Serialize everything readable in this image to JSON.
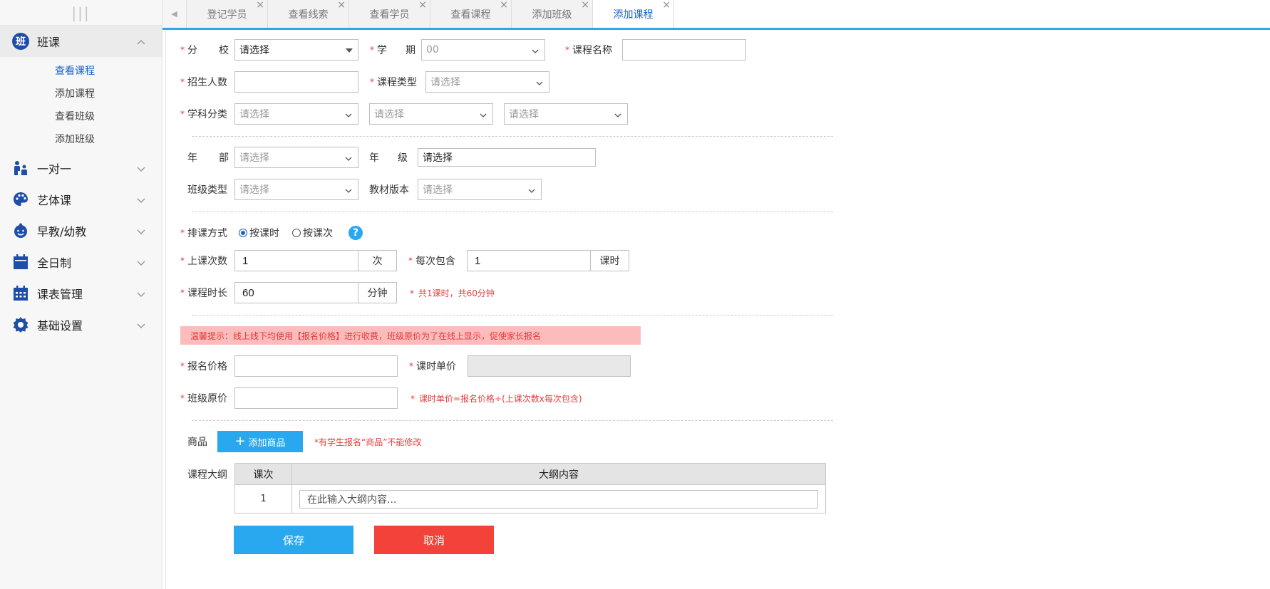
{
  "sidebar": {
    "top_glyph": "|||",
    "groups": [
      {
        "label": "班课",
        "badge": "班",
        "icon": "ban-badge"
      },
      {
        "label": "一对一",
        "icon": "teacher-student-icon"
      },
      {
        "label": "艺体课",
        "icon": "palette-icon"
      },
      {
        "label": "早教/幼教",
        "icon": "baby-face-icon"
      },
      {
        "label": "全日制",
        "icon": "calendar-icon"
      },
      {
        "label": "课表管理",
        "icon": "schedule-icon"
      },
      {
        "label": "基础设置",
        "icon": "gear-icon"
      }
    ],
    "sub_items": [
      "查看课程",
      "添加课程",
      "查看班级",
      "添加班级"
    ]
  },
  "tabs": [
    {
      "label": "登记学员"
    },
    {
      "label": "查看线索"
    },
    {
      "label": "查看学员"
    },
    {
      "label": "查看课程"
    },
    {
      "label": "添加班级"
    },
    {
      "label": "添加课程"
    }
  ],
  "tab_close_glyph": "×",
  "tab_prev_glyph": "◀",
  "form": {
    "branch": {
      "label_a": "分",
      "label_b": "校",
      "value": "请选择"
    },
    "term": {
      "label_a": "学",
      "label_b": "期",
      "value": "00"
    },
    "course_name": {
      "label": "课程名称",
      "value": ""
    },
    "enroll_count": {
      "label": "招生人数",
      "value": ""
    },
    "course_type": {
      "label": "课程类型",
      "value": "请选择"
    },
    "subject": {
      "label": "学科分类",
      "values": [
        "请选择",
        "请选择",
        "请选择"
      ]
    },
    "grade_dept": {
      "label_a": "年",
      "label_b": "部",
      "value": "请选择"
    },
    "grade": {
      "label_a": "年",
      "label_b": "级",
      "value": "请选择"
    },
    "class_type": {
      "label": "班级类型",
      "value": "请选择"
    },
    "textbook": {
      "label": "教材版本",
      "value": "请选择"
    },
    "schedule_mode": {
      "label": "排课方式",
      "option_hour": "按课时",
      "option_session": "按课次",
      "selected": "按课时",
      "help": "?"
    },
    "sessions": {
      "label": "上课次数",
      "value": "1",
      "unit": "次"
    },
    "per_session": {
      "label": "每次包含",
      "value": "1",
      "unit": "课时"
    },
    "duration": {
      "label": "课程时长",
      "value": "60",
      "unit": "分钟",
      "hint": "共1课时，共60分钟"
    },
    "tip": "温馨提示：线上线下均使用【报名价格】进行收费，班级原价为了在线上显示，促使家长报名",
    "reg_price": {
      "label": "报名价格",
      "value": ""
    },
    "unit_price": {
      "label": "课时单价",
      "value": ""
    },
    "orig_price": {
      "label": "班级原价",
      "value": "",
      "hint": "课时单价=报名价格÷(上课次数x每次包含)"
    },
    "goods": {
      "label": "商品",
      "add_label": "添加商品",
      "hint": "*有学生报名“商品”不能修改"
    },
    "outline": {
      "label": "课程大纲",
      "headers": [
        "课次",
        "大纲内容"
      ],
      "rows": [
        {
          "index": "1",
          "placeholder": "在此输入大纲内容..."
        }
      ]
    },
    "required_mark": "*",
    "save_label": "保存",
    "cancel_label": "取消"
  },
  "colors": {
    "accent": "#2aa8ef",
    "danger": "#f2423a",
    "active_text": "#1a63c5",
    "brand": "#1e4fa8"
  }
}
